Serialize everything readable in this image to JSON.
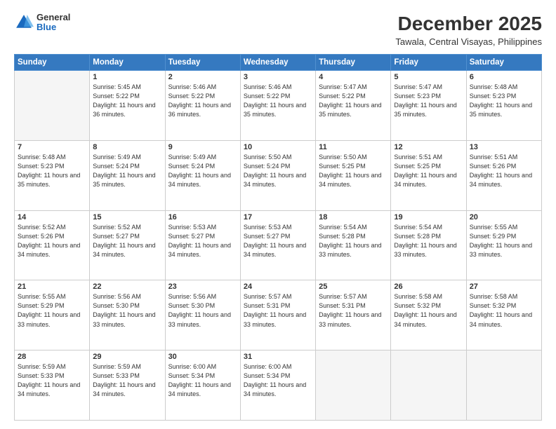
{
  "header": {
    "logo_general": "General",
    "logo_blue": "Blue",
    "main_title": "December 2025",
    "subtitle": "Tawala, Central Visayas, Philippines"
  },
  "days_of_week": [
    "Sunday",
    "Monday",
    "Tuesday",
    "Wednesday",
    "Thursday",
    "Friday",
    "Saturday"
  ],
  "weeks": [
    [
      {
        "day": "",
        "empty": true
      },
      {
        "day": "1",
        "sunrise": "5:45 AM",
        "sunset": "5:22 PM",
        "daylight": "11 hours and 36 minutes."
      },
      {
        "day": "2",
        "sunrise": "5:46 AM",
        "sunset": "5:22 PM",
        "daylight": "11 hours and 36 minutes."
      },
      {
        "day": "3",
        "sunrise": "5:46 AM",
        "sunset": "5:22 PM",
        "daylight": "11 hours and 35 minutes."
      },
      {
        "day": "4",
        "sunrise": "5:47 AM",
        "sunset": "5:22 PM",
        "daylight": "11 hours and 35 minutes."
      },
      {
        "day": "5",
        "sunrise": "5:47 AM",
        "sunset": "5:23 PM",
        "daylight": "11 hours and 35 minutes."
      },
      {
        "day": "6",
        "sunrise": "5:48 AM",
        "sunset": "5:23 PM",
        "daylight": "11 hours and 35 minutes."
      }
    ],
    [
      {
        "day": "7",
        "sunrise": "5:48 AM",
        "sunset": "5:23 PM",
        "daylight": "11 hours and 35 minutes."
      },
      {
        "day": "8",
        "sunrise": "5:49 AM",
        "sunset": "5:24 PM",
        "daylight": "11 hours and 35 minutes."
      },
      {
        "day": "9",
        "sunrise": "5:49 AM",
        "sunset": "5:24 PM",
        "daylight": "11 hours and 34 minutes."
      },
      {
        "day": "10",
        "sunrise": "5:50 AM",
        "sunset": "5:24 PM",
        "daylight": "11 hours and 34 minutes."
      },
      {
        "day": "11",
        "sunrise": "5:50 AM",
        "sunset": "5:25 PM",
        "daylight": "11 hours and 34 minutes."
      },
      {
        "day": "12",
        "sunrise": "5:51 AM",
        "sunset": "5:25 PM",
        "daylight": "11 hours and 34 minutes."
      },
      {
        "day": "13",
        "sunrise": "5:51 AM",
        "sunset": "5:26 PM",
        "daylight": "11 hours and 34 minutes."
      }
    ],
    [
      {
        "day": "14",
        "sunrise": "5:52 AM",
        "sunset": "5:26 PM",
        "daylight": "11 hours and 34 minutes."
      },
      {
        "day": "15",
        "sunrise": "5:52 AM",
        "sunset": "5:27 PM",
        "daylight": "11 hours and 34 minutes."
      },
      {
        "day": "16",
        "sunrise": "5:53 AM",
        "sunset": "5:27 PM",
        "daylight": "11 hours and 34 minutes."
      },
      {
        "day": "17",
        "sunrise": "5:53 AM",
        "sunset": "5:27 PM",
        "daylight": "11 hours and 34 minutes."
      },
      {
        "day": "18",
        "sunrise": "5:54 AM",
        "sunset": "5:28 PM",
        "daylight": "11 hours and 33 minutes."
      },
      {
        "day": "19",
        "sunrise": "5:54 AM",
        "sunset": "5:28 PM",
        "daylight": "11 hours and 33 minutes."
      },
      {
        "day": "20",
        "sunrise": "5:55 AM",
        "sunset": "5:29 PM",
        "daylight": "11 hours and 33 minutes."
      }
    ],
    [
      {
        "day": "21",
        "sunrise": "5:55 AM",
        "sunset": "5:29 PM",
        "daylight": "11 hours and 33 minutes."
      },
      {
        "day": "22",
        "sunrise": "5:56 AM",
        "sunset": "5:30 PM",
        "daylight": "11 hours and 33 minutes."
      },
      {
        "day": "23",
        "sunrise": "5:56 AM",
        "sunset": "5:30 PM",
        "daylight": "11 hours and 33 minutes."
      },
      {
        "day": "24",
        "sunrise": "5:57 AM",
        "sunset": "5:31 PM",
        "daylight": "11 hours and 33 minutes."
      },
      {
        "day": "25",
        "sunrise": "5:57 AM",
        "sunset": "5:31 PM",
        "daylight": "11 hours and 33 minutes."
      },
      {
        "day": "26",
        "sunrise": "5:58 AM",
        "sunset": "5:32 PM",
        "daylight": "11 hours and 34 minutes."
      },
      {
        "day": "27",
        "sunrise": "5:58 AM",
        "sunset": "5:32 PM",
        "daylight": "11 hours and 34 minutes."
      }
    ],
    [
      {
        "day": "28",
        "sunrise": "5:59 AM",
        "sunset": "5:33 PM",
        "daylight": "11 hours and 34 minutes."
      },
      {
        "day": "29",
        "sunrise": "5:59 AM",
        "sunset": "5:33 PM",
        "daylight": "11 hours and 34 minutes."
      },
      {
        "day": "30",
        "sunrise": "6:00 AM",
        "sunset": "5:34 PM",
        "daylight": "11 hours and 34 minutes."
      },
      {
        "day": "31",
        "sunrise": "6:00 AM",
        "sunset": "5:34 PM",
        "daylight": "11 hours and 34 minutes."
      },
      {
        "day": "",
        "empty": true
      },
      {
        "day": "",
        "empty": true
      },
      {
        "day": "",
        "empty": true
      }
    ]
  ]
}
